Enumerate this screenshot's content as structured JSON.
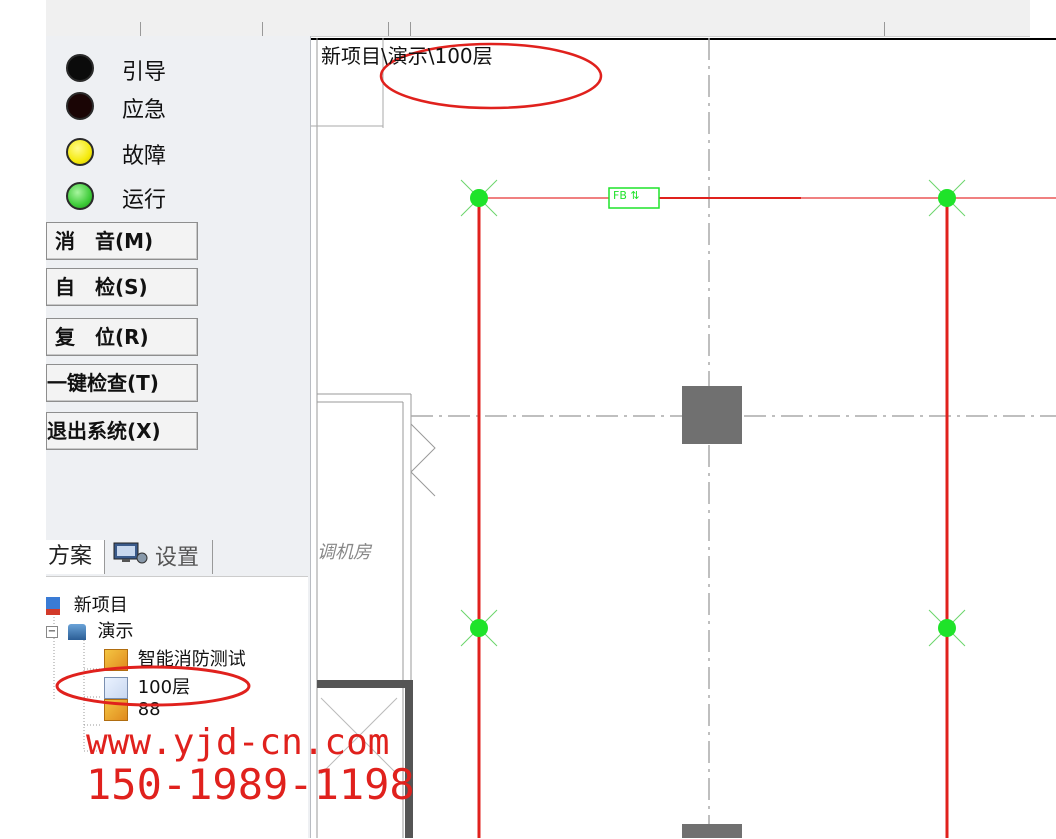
{
  "indicators": [
    {
      "label": "引导",
      "color": "#0b0b0b",
      "state": "off"
    },
    {
      "label": "应急",
      "color": "#1a0505",
      "state": "off"
    },
    {
      "label": "故障",
      "color": "#f5ea0d",
      "state": "on"
    },
    {
      "label": "运行",
      "color": "#3fcc3a",
      "state": "on"
    }
  ],
  "buttons": {
    "mute": "消　音(M)",
    "self_check": "自　检(S)",
    "reset": "复　位(R)",
    "one_key_check": "一键检查(T)",
    "exit": "退出系统(X)"
  },
  "tabs": {
    "plan": "方案",
    "settings": "设置"
  },
  "tree": {
    "root": "新项目",
    "demo": "演示",
    "items": [
      "智能消防测试",
      "100层",
      "88"
    ]
  },
  "canvas": {
    "breadcrumb": "新项目\\演示\\100层",
    "room_label": "调机房",
    "device_label": "FB ⇅"
  },
  "watermark": {
    "url": "www.yjd-cn.com",
    "phone": "150-1989-1198"
  },
  "colors": {
    "accent_red": "#e0211d",
    "node_green": "#1fe32a",
    "panel_bg": "#eef0f3"
  }
}
